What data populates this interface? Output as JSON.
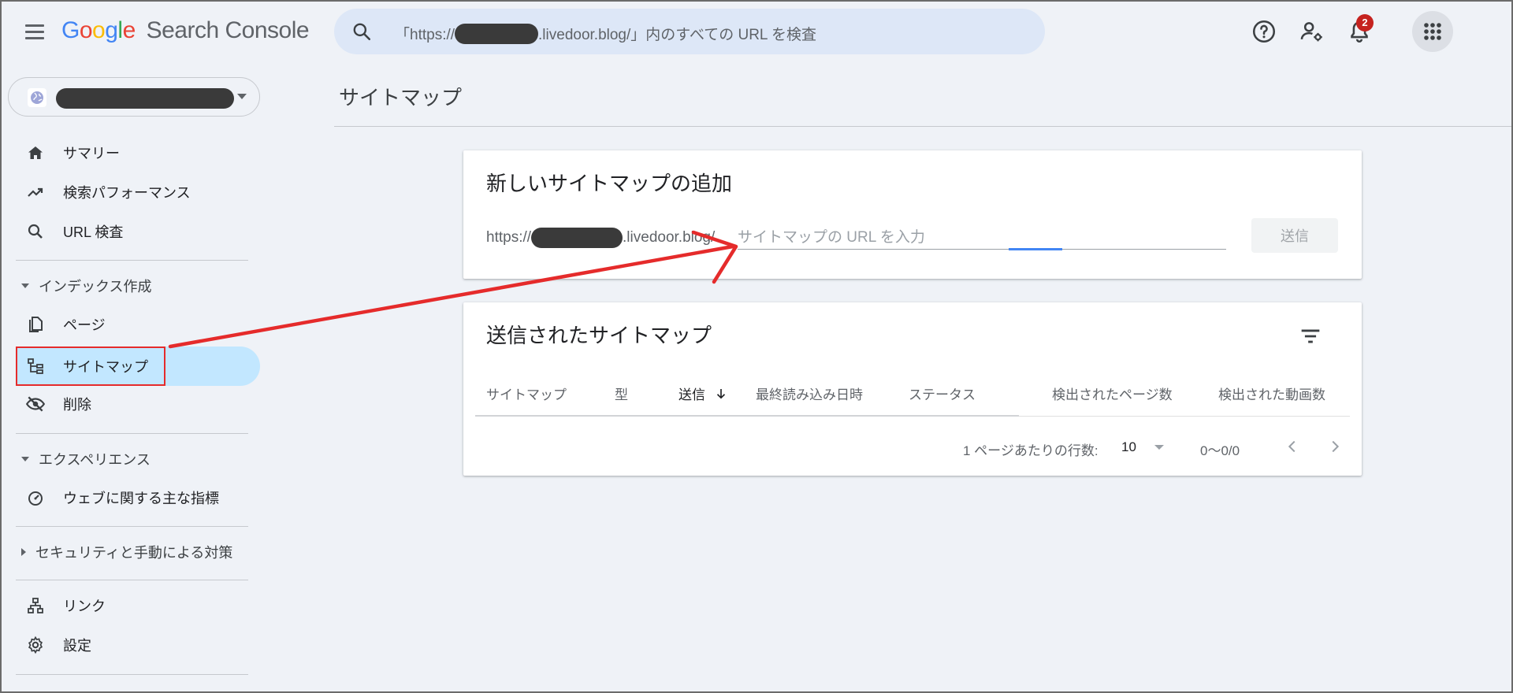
{
  "app": {
    "logo_google": [
      "G",
      "o",
      "o",
      "g",
      "l",
      "e"
    ],
    "logo_colors": [
      "#4285f4",
      "#ea4335",
      "#fbbc05",
      "#4285f4",
      "#34a853",
      "#ea4335"
    ],
    "logo_product": "Search Console"
  },
  "search": {
    "prefix": "「https://",
    "suffix": ".livedoor.blog/」内のすべての URL を検査",
    "icon": "search-icon"
  },
  "header": {
    "help_icon": "help-icon",
    "user_settings_icon": "manage-users-icon",
    "notifications_icon": "bell-icon",
    "notification_count": "2",
    "apps_icon": "apps-grid-icon"
  },
  "sidebar": {
    "items": [
      {
        "label": "サマリー",
        "icon": "home-icon"
      },
      {
        "label": "検索パフォーマンス",
        "icon": "trending-up-icon"
      },
      {
        "label": "URL 検査",
        "icon": "search-icon"
      },
      {
        "label": "ページ",
        "icon": "pages-icon"
      },
      {
        "label": "サイトマップ",
        "icon": "sitemap-icon"
      },
      {
        "label": "削除",
        "icon": "visibility-off-icon"
      },
      {
        "label": "ウェブに関する主な指標",
        "icon": "speed-icon"
      },
      {
        "label": "リンク",
        "icon": "links-icon"
      },
      {
        "label": "設定",
        "icon": "settings-icon"
      }
    ],
    "sections": [
      "インデックス作成",
      "エクスペリエンス",
      "セキュリティと手動による対策"
    ],
    "active_item": "サイトマップ"
  },
  "main": {
    "page_title": "サイトマップ",
    "add_card": {
      "title": "新しいサイトマップの追加",
      "url_prefix_start": "https://",
      "url_prefix_end": ".livedoor.blog/",
      "input_placeholder": "サイトマップの URL を入力",
      "submit_label": "送信"
    },
    "submitted_card": {
      "title": "送信されたサイトマップ",
      "columns": [
        "サイトマップ",
        "型",
        "送信",
        "最終読み込み日時",
        "ステータス",
        "検出されたページ数",
        "検出された動画数"
      ],
      "sorted_column": "送信",
      "rows_per_page_label": "1 ページあたりの行数:",
      "rows_per_page_value": "10",
      "range": "0〜0/0"
    }
  },
  "colors": {
    "accent": "#4285f4",
    "active_nav": "#c2e7ff",
    "annotation_red": "#e52b2b",
    "badge": "#c5221f"
  }
}
